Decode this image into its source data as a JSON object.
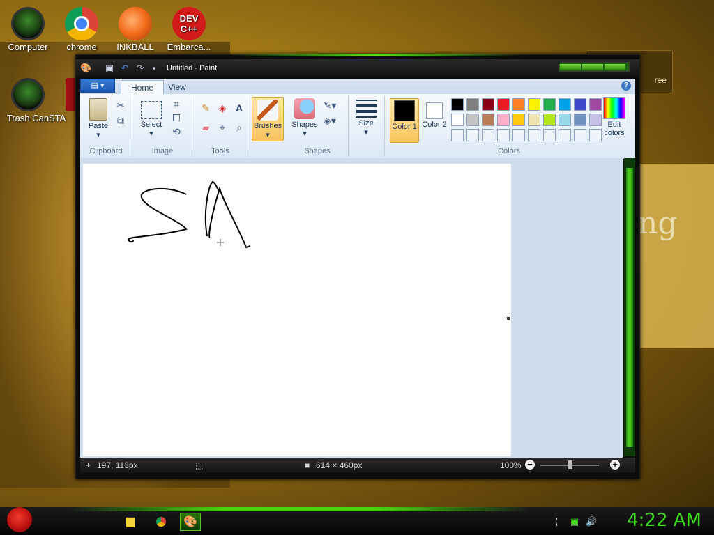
{
  "desktop": {
    "icons": [
      {
        "label": "Computer",
        "icon": "computer-icon"
      },
      {
        "label": "chrome",
        "icon": "chrome-icon"
      },
      {
        "label": "INKBALL",
        "icon": "inkball-icon"
      },
      {
        "label": "Embarca...",
        "icon": "devcpp-icon",
        "icon_text": "DEV\nC++"
      },
      {
        "label": "Trash Can",
        "icon": "trash-icon"
      },
      {
        "label": "STA",
        "icon": "app-icon"
      }
    ],
    "wallpaper_text": "ng",
    "gadget_label": "ree"
  },
  "paint": {
    "title": "Untitled - Paint",
    "app_menu_label": "▤ ▾",
    "tabs": [
      "Home",
      "View"
    ],
    "active_tab": "Home",
    "groups": {
      "clipboard": {
        "label": "Clipboard",
        "paste": "Paste"
      },
      "image": {
        "label": "Image",
        "select": "Select"
      },
      "tools": {
        "label": "Tools"
      },
      "brushes": {
        "label": "Brushes"
      },
      "shapes": {
        "label": "Shapes",
        "shapes_btn": "Shapes"
      },
      "size": {
        "label": "Size"
      },
      "colors": {
        "label": "Colors",
        "color1_label": "Color 1",
        "color2_label": "Color 2",
        "edit_colors_label": "Edit colors",
        "color1": "#000000",
        "color2": "#ffffff",
        "palette_row1": [
          "#000000",
          "#7f7f7f",
          "#880015",
          "#ed1c24",
          "#ff7f27",
          "#fff200",
          "#22b14c",
          "#00a2e8",
          "#3f48cc",
          "#a349a4"
        ],
        "palette_row2": [
          "#ffffff",
          "#c3c3c3",
          "#b97a57",
          "#ffaec9",
          "#ffc90e",
          "#efe4b0",
          "#b5e61d",
          "#99d9ea",
          "#7092be",
          "#c8bfe7"
        ]
      }
    },
    "status": {
      "cursor_pos": "197, 113px",
      "canvas_size": "614 × 460px",
      "zoom": "100%"
    }
  },
  "taskbar": {
    "clock": "4:22 AM",
    "items": [
      "explorer",
      "chrome",
      "paint"
    ]
  }
}
